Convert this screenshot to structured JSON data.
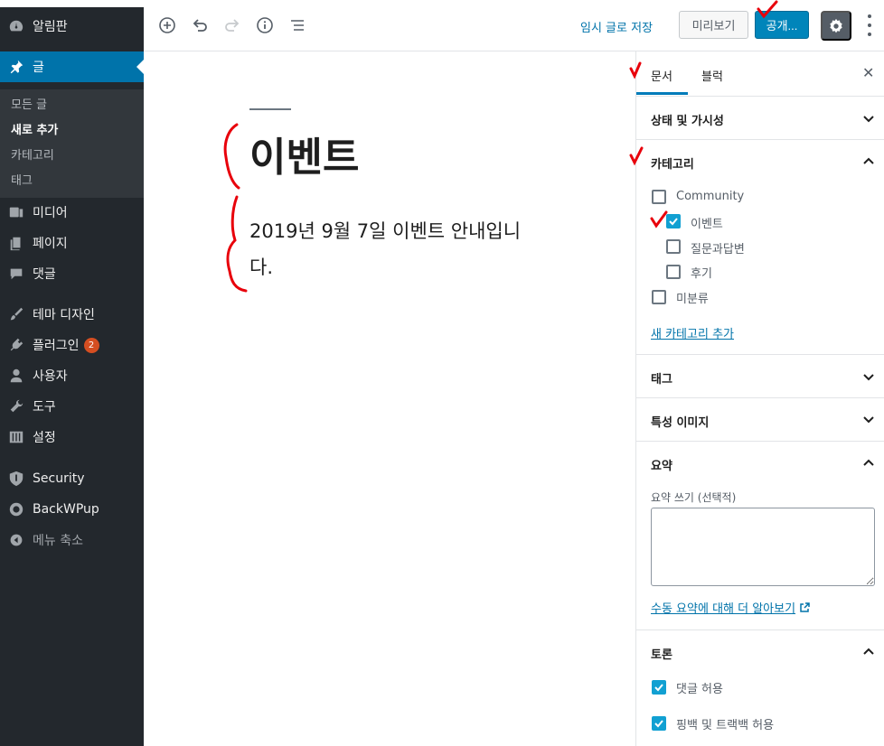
{
  "sidebar": {
    "items": [
      {
        "label": "알림판",
        "icon": "dashboard-icon"
      },
      {
        "label": "글",
        "icon": "pushpin-icon"
      },
      {
        "label": "미디어",
        "icon": "media-icon"
      },
      {
        "label": "페이지",
        "icon": "pages-icon"
      },
      {
        "label": "댓글",
        "icon": "comments-icon"
      },
      {
        "label": "테마 디자인",
        "icon": "brush-icon"
      },
      {
        "label": "플러그인",
        "icon": "plugin-icon",
        "badge": "2"
      },
      {
        "label": "사용자",
        "icon": "user-icon"
      },
      {
        "label": "도구",
        "icon": "wrench-icon"
      },
      {
        "label": "설정",
        "icon": "settings-sliders-icon"
      },
      {
        "label": "Security",
        "icon": "shield-icon"
      },
      {
        "label": "BackWPup",
        "icon": "backwpup-icon"
      },
      {
        "label": "메뉴 축소",
        "icon": "collapse-icon"
      }
    ],
    "submenu": [
      "모든 글",
      "새로 추가",
      "카테고리",
      "태그"
    ]
  },
  "toolbar": {
    "draft_label": "임시 글로 저장",
    "preview_label": "미리보기",
    "publish_label": "공개...",
    "icons": [
      "add-block-icon",
      "undo-icon",
      "redo-icon",
      "info-icon",
      "outline-icon",
      "settings-gear-icon",
      "more-vertical-icon"
    ]
  },
  "post": {
    "title": "이벤트",
    "body": "2019년 9월 7일 이벤트 안내입니다."
  },
  "panel": {
    "tab_document": "문서",
    "tab_block": "블럭",
    "close": "✕",
    "sections": {
      "status": "상태 및 가시성",
      "categories": "카테고리",
      "tags": "태그",
      "featured": "특성 이미지",
      "excerpt": "요약",
      "discussion": "토론"
    },
    "categories": [
      {
        "label": "Community",
        "checked": false,
        "level": 0
      },
      {
        "label": "이벤트",
        "checked": true,
        "level": 1
      },
      {
        "label": "질문과답변",
        "checked": false,
        "level": 1
      },
      {
        "label": "후기",
        "checked": false,
        "level": 1
      },
      {
        "label": "미분류",
        "checked": false,
        "level": 0
      }
    ],
    "add_category": "새 카테고리 추가",
    "excerpt_label": "요약 쓰기 (선택적)",
    "excerpt_value": "",
    "excerpt_link": "수동 요약에 대해 더 알아보기",
    "discussion": [
      {
        "label": "댓글 허용",
        "checked": true
      },
      {
        "label": "핑백 및 트랙백 허용",
        "checked": true
      }
    ]
  },
  "colors": {
    "admin_bg": "#23282d",
    "accent": "#0073aa",
    "checkbox": "#11a0d2",
    "annotation": "#e8000b"
  }
}
